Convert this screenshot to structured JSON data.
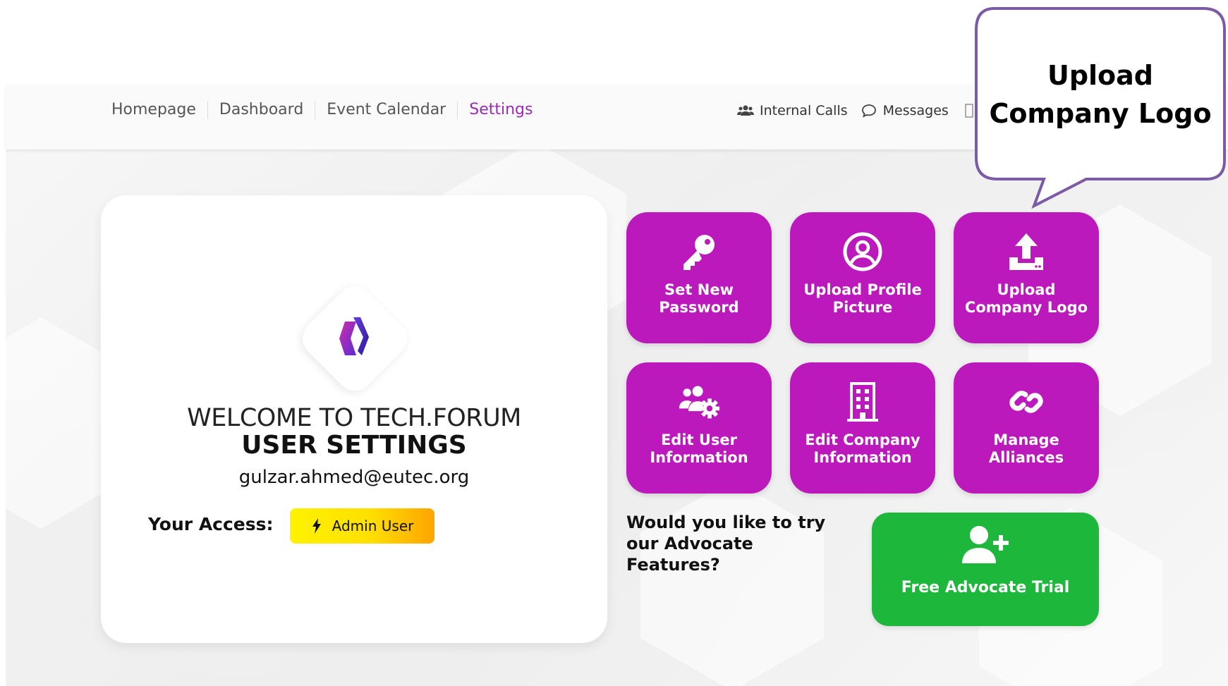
{
  "nav": {
    "items": [
      {
        "label": "Homepage"
      },
      {
        "label": "Dashboard"
      },
      {
        "label": "Event Calendar"
      },
      {
        "label": "Settings"
      }
    ],
    "active": "Settings"
  },
  "right_nav": {
    "internal_calls": "Internal Calls",
    "messages": "Messages"
  },
  "card": {
    "welcome": "WELCOME TO TECH.FORUM",
    "title": "USER SETTINGS",
    "email": "gulzar.ahmed@eutec.org",
    "access_label": "Your Access:",
    "access_badge": "Admin User"
  },
  "tiles": [
    {
      "label": "Set New Password",
      "icon": "key-icon"
    },
    {
      "label": "Upload Profile Picture",
      "icon": "user-circle-icon"
    },
    {
      "label": "Upload Company Logo",
      "icon": "upload-icon"
    },
    {
      "label": "Edit User Information",
      "icon": "users-gear-icon"
    },
    {
      "label": "Edit Company Information",
      "icon": "building-icon"
    },
    {
      "label": "Manage Alliances",
      "icon": "link-icon"
    }
  ],
  "advocate": {
    "question": "Would you like to try our Advocate Features?",
    "button": "Free Advocate Trial"
  },
  "callout": {
    "text": "Upload Company Logo"
  },
  "colors": {
    "tile": "#bc19bc",
    "active_nav": "#9b2bb0",
    "green": "#1db83b",
    "callout_border": "#7b5aa6",
    "badge_start": "#fff200",
    "badge_end": "#ffa400"
  }
}
